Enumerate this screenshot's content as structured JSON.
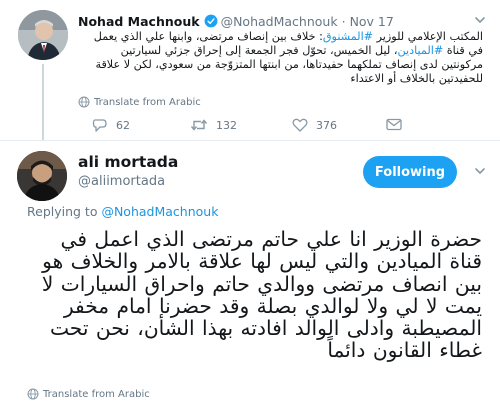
{
  "parent_tweet": {
    "display_name": "Nohad Machnouk",
    "handle": "@NohadMachnouk",
    "separator": "·",
    "date": "Nov 17",
    "text": {
      "part1": "المكتب الإعلامي للوزير ",
      "hashtag1": "#المشنوق",
      "part2": ": خلاف بين إنصاف مرتضى، وابنها علي الذي يعمل في قناة ",
      "hashtag2": "#الميادين",
      "part3": "، ليل الخميس، تحوّل فجر الجمعة إلى إحراق جزئي لسيارتين مركونتين لدى إنصاف تملكهما حفيدتاها، من ابنتها المتزوّجة من سعودي، لكن لا علاقة للحفيدتين بالخلاف أو الاعتداء"
    },
    "translate_label": "Translate from Arabic",
    "replies": "62",
    "retweets": "132",
    "likes": "376"
  },
  "reply_tweet": {
    "display_name": "ali mortada",
    "handle": "@aliimortada",
    "follow_label": "Following",
    "replying_prefix": "Replying to ",
    "replying_to": "@NohadMachnouk",
    "text": "حضرة الوزير انا علي حاتم مرتضى الذي اعمل في قناة الميادين والتي ليس لها علاقة بالامر والخلاف هو بين انصاف مرتضى ووالدي حاتم واحراق السيارات لا يمت لا لي ولا لوالدي بصلة وقد حضرنا امام مخفر المصيطبة وادلى الوالد افادته بهذا الشأن، نحن تحت غطاء القانون دائماً",
    "translate_label": "Translate from Arabic"
  },
  "colors": {
    "brand_blue": "#1da1f2",
    "link_blue": "#1b95e0",
    "secondary_text": "#657786",
    "primary_text": "#14171a",
    "divider": "#e6ecf0"
  },
  "icons": [
    "verified-badge-icon",
    "chevron-down-icon",
    "globe-icon",
    "reply-icon",
    "retweet-icon",
    "like-icon",
    "direct-message-icon"
  ]
}
